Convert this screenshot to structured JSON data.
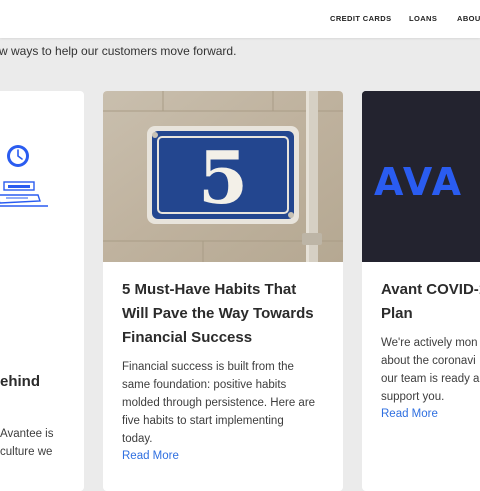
{
  "nav": {
    "items": [
      "CREDIT CARDS",
      "LOANS",
      "ABOUT"
    ]
  },
  "intro": {
    "text": "w ways to help our customers move forward."
  },
  "cards": [
    {
      "title_lines": [
        "ehind"
      ],
      "body_lines": [
        "Avantee is",
        "culture we"
      ],
      "icons": [
        "clock-icon",
        "laptop-icon"
      ]
    },
    {
      "image_text": "5",
      "title_lines": [
        "5 Must-Have Habits That",
        "Will Pave the Way Towards",
        "Financial Success"
      ],
      "body_lines": [
        "Financial success is built from the",
        "same foundation: positive habits",
        "molded through persistence. Here are",
        "five habits to start implementing",
        "today."
      ],
      "read_more": "Read More"
    },
    {
      "logo_text": "AVA",
      "title_lines": [
        "Avant COVID-1",
        "Plan"
      ],
      "body_lines": [
        "We're actively mon",
        "about the coronavi",
        "our team is ready a",
        "support you."
      ],
      "read_more": "Read More"
    }
  ],
  "colors": {
    "accent_blue": "#2f6fe0",
    "logo_blue": "#2a5cf0",
    "dark_card_bg": "#23232f",
    "plaque_blue": "#23468f",
    "page_bg": "#ebebeb"
  }
}
